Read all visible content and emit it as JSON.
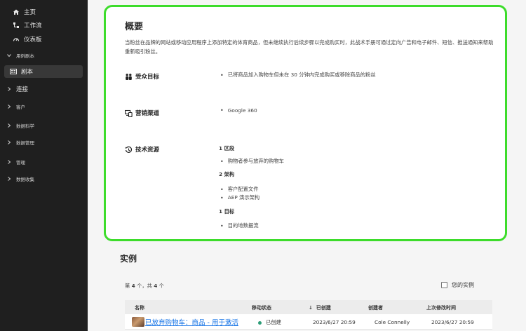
{
  "sidebar": {
    "items": [
      {
        "label": "主页",
        "icon": "home-icon"
      },
      {
        "label": "工作流",
        "icon": "workflow-icon"
      },
      {
        "label": "仪表板",
        "icon": "dashboard-icon"
      },
      {
        "label": "用例剧本",
        "icon": "chevron-down-icon"
      },
      {
        "label": "剧本",
        "icon": "playbook-icon"
      },
      {
        "label": "连接",
        "icon": "chevron-right-icon"
      },
      {
        "label": "客户",
        "icon": "chevron-right-icon"
      },
      {
        "label": "数据科学",
        "icon": "chevron-right-icon"
      },
      {
        "label": "数据管理",
        "icon": "chevron-right-icon"
      },
      {
        "label": "管理",
        "icon": "chevron-right-icon"
      },
      {
        "label": "数据收集",
        "icon": "chevron-right-icon"
      }
    ]
  },
  "overview": {
    "title": "概要",
    "description": "当粉丝在品牌的网站或移动应用程序上添加特定的体育商品，但未继续执行后续步骤以完成购买时，此战术手册可通过定向广告和电子邮件、短信、推送通知来帮助重新吸引粉丝。",
    "audience": {
      "label": "受众目标",
      "icon": "audience-icon",
      "items": [
        "已将商品加入购物车但未在 30 分钟内完成购买或移除商品的粉丝"
      ]
    },
    "channels": {
      "label": "营销渠道",
      "icon": "channels-icon",
      "items": [
        "Google 360"
      ]
    },
    "resources": {
      "label": "技术资源",
      "icon": "resources-icon",
      "groups": [
        {
          "heading": "1 区段",
          "items": [
            "购物者参与放弃的购物车"
          ]
        },
        {
          "heading": "2 架构",
          "items": [
            "客户配置文件",
            "AEP 演示架构"
          ]
        },
        {
          "heading": "1 目标",
          "items": [
            "目的地数据流"
          ]
        }
      ]
    }
  },
  "instances": {
    "title": "实例",
    "count_prefix": "第 ",
    "count_shown": "4",
    "count_mid": " 个，共 ",
    "count_total": "4",
    "count_suffix": " 个",
    "your_instances_label": "您的实例",
    "columns": {
      "name": "名称",
      "status": "移动状态",
      "created": "已创建",
      "creator": "创建者",
      "modified": "上次修改时间"
    },
    "rows": [
      {
        "name": "已放弃购物车：商品 - 用于激活",
        "status": "已创建",
        "created": "2023/6/27 20:59",
        "creator": "Cole Connelly",
        "modified": "2023/6/27 20:59"
      }
    ]
  },
  "colors": {
    "sidebar_bg": "#1f1f1f",
    "highlight_border": "#3ddc2b",
    "link": "#1473e6",
    "status_green": "#2d9d78"
  }
}
